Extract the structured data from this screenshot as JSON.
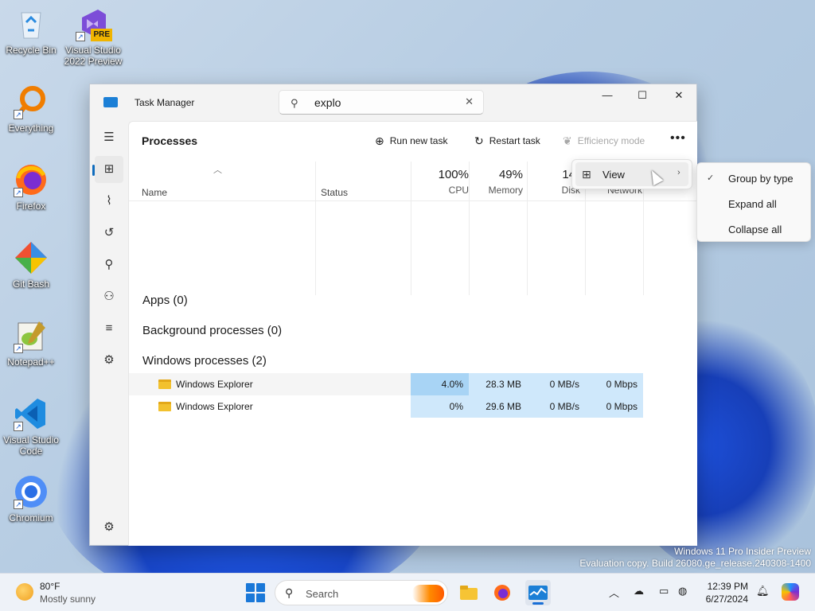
{
  "desktop": {
    "icons": [
      {
        "label": "Recycle Bin",
        "icon": "recycle-bin-icon"
      },
      {
        "label": "Visual Studio 2022 Preview",
        "icon": "visual-studio-icon",
        "badge": "PRE"
      },
      {
        "label": "Everything",
        "icon": "everything-search-icon"
      },
      {
        "label": "Firefox",
        "icon": "firefox-icon"
      },
      {
        "label": "Git Bash",
        "icon": "git-bash-icon"
      },
      {
        "label": "Notepad++",
        "icon": "notepad-plus-plus-icon"
      },
      {
        "label": "Visual Studio Code",
        "icon": "vscode-icon"
      },
      {
        "label": "Chromium",
        "icon": "chromium-icon"
      }
    ],
    "watermark": {
      "line1": "Windows 11 Pro Insider Preview",
      "line2": "Evaluation copy. Build 26080.ge_release.240308-1400"
    }
  },
  "window": {
    "title": "Task Manager",
    "search": {
      "value": "explo"
    },
    "controls": {
      "minimize": "—",
      "maximize": "☐",
      "close": "✕"
    }
  },
  "sidebar": {
    "items": [
      {
        "name": "hamburger-menu-icon",
        "glyph": "☰"
      },
      {
        "name": "processes-icon",
        "glyph": "⊞"
      },
      {
        "name": "performance-icon",
        "glyph": "⌇"
      },
      {
        "name": "app-history-icon",
        "glyph": "↺"
      },
      {
        "name": "startup-apps-icon",
        "glyph": "⚲"
      },
      {
        "name": "users-icon",
        "glyph": "⚇"
      },
      {
        "name": "details-icon",
        "glyph": "≡"
      },
      {
        "name": "services-icon",
        "glyph": "⚙"
      }
    ],
    "settings_glyph": "⚙"
  },
  "toolbar": {
    "page_title": "Processes",
    "run_new_task": "Run new task",
    "restart_task": "Restart task",
    "efficiency_mode": "Efficiency mode",
    "more": "•••"
  },
  "table": {
    "columns": {
      "name": "Name",
      "status": "Status",
      "cpu_pct": "100%",
      "cpu": "CPU",
      "memory_pct": "49%",
      "memory": "Memory",
      "disk_pct": "14°",
      "disk": "Disk",
      "network": "Network"
    },
    "groups": {
      "apps": "Apps (0)",
      "background": "Background processes (0)",
      "windows": "Windows processes (2)"
    },
    "rows": [
      {
        "name": "Windows Explorer",
        "cpu": "4.0%",
        "memory": "28.3 MB",
        "disk": "0 MB/s",
        "network": "0 Mbps"
      },
      {
        "name": "Windows Explorer",
        "cpu": "0%",
        "memory": "29.6 MB",
        "disk": "0 MB/s",
        "network": "0 Mbps"
      }
    ]
  },
  "menus": {
    "view": "View",
    "submenu": {
      "group_by_type": "Group by type",
      "expand_all": "Expand all",
      "collapse_all": "Collapse all",
      "checked": "✓"
    }
  },
  "taskbar": {
    "weather": {
      "temp": "80°F",
      "desc": "Mostly sunny"
    },
    "search_label": "Search",
    "clock": {
      "time": "12:39 PM",
      "date": "6/27/2024"
    }
  },
  "colors": {
    "accent": "#0f6cbd",
    "cpu_high": "#a8d4f5",
    "cpu_low": "#cfe8fb"
  }
}
